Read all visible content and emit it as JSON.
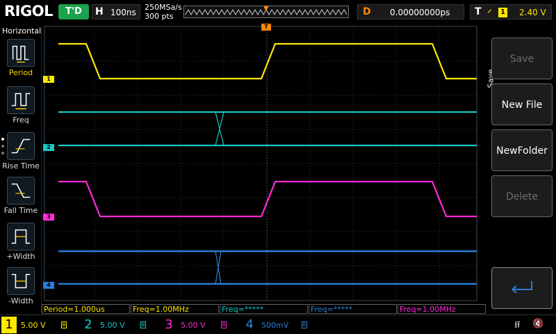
{
  "topbar": {
    "brand": "RIGOL",
    "run_state": "T'D",
    "timebase_label": "H",
    "timebase_value": "100ns",
    "sample_rate": "250MSa/s",
    "memory_depth": "300 pts",
    "delay_label": "D",
    "delay_value": "0.00000000ps",
    "trigger_label": "T",
    "trigger_slope": "rising-edge-icon",
    "trigger_source": "1",
    "trigger_level": "2.40 V"
  },
  "left_panel": {
    "title": "Horizontal",
    "items": [
      {
        "label": "Period",
        "icon": "period-icon",
        "selected": true
      },
      {
        "label": "Freq",
        "icon": "frequency-icon",
        "selected": false
      },
      {
        "label": "Rise Time",
        "icon": "rise-time-icon",
        "selected": false
      },
      {
        "label": "Fall Time",
        "icon": "fall-time-icon",
        "selected": false
      },
      {
        "label": "+Width",
        "icon": "positive-width-icon",
        "selected": false
      },
      {
        "label": "-Width",
        "icon": "negative-width-icon",
        "selected": false
      }
    ]
  },
  "channels_display": {
    "ch1_marker": "1",
    "ch2_marker": "2",
    "ch3_marker": "3",
    "ch4_marker": "4",
    "trigger_marker": "T"
  },
  "measurements": [
    {
      "text": "Period=1.000us",
      "color": "#ffe800"
    },
    {
      "text": "Freq=1.00MHz",
      "color": "#ffe800"
    },
    {
      "text": "Freq=*****",
      "color": "#19c7c7"
    },
    {
      "text": "Freq=*****",
      "color": "#2b7fd8"
    },
    {
      "text": "Freq=1.00MHz",
      "color": "#ff2bd6"
    }
  ],
  "right_menu": {
    "title": "Save",
    "buttons": [
      {
        "label": "Save",
        "enabled": false
      },
      {
        "label": "New File",
        "enabled": true
      },
      {
        "label": "NewFolder",
        "enabled": true
      },
      {
        "label": "Delete",
        "enabled": false
      },
      {
        "label": "",
        "icon": "return-icon",
        "enabled": true
      }
    ]
  },
  "bottom_bar": {
    "ch1": {
      "num": "1",
      "scale": "5.00 V",
      "color": "#ffe800"
    },
    "ch2": {
      "num": "2",
      "scale": "5.00 V",
      "color": "#19c7c7"
    },
    "ch3": {
      "num": "3",
      "scale": "5.00 V",
      "color": "#ff2bd6"
    },
    "ch4": {
      "num": "4",
      "scale": "500mV",
      "color": "#2b7fd8"
    },
    "usb_icon": "usb-icon",
    "speaker_icon": "speaker-muted-icon"
  },
  "colors": {
    "ch1": "#ffe800",
    "ch2": "#19c7c7",
    "ch3": "#ff2bd6",
    "ch4": "#2b7fd8",
    "trigger": "#ff8a00",
    "run": "#1aa34a",
    "grid": "#2a3a4a"
  }
}
